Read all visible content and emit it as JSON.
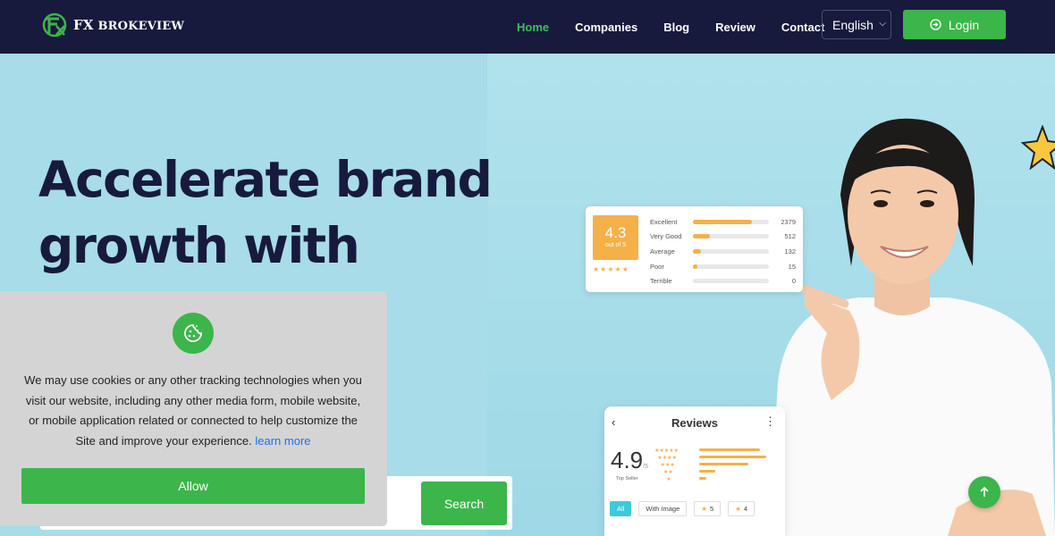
{
  "brand": {
    "name": "FX BROKEVIEW",
    "prefix": "FX",
    "suffix": "BROKEVIEW"
  },
  "nav": {
    "items": [
      {
        "label": "Home",
        "active": true
      },
      {
        "label": "Companies",
        "active": false
      },
      {
        "label": "Blog",
        "active": false
      },
      {
        "label": "Review",
        "active": false
      },
      {
        "label": "Contact",
        "active": false
      }
    ],
    "language": "English",
    "login_label": "Login"
  },
  "hero": {
    "headline_line1": "Accelerate brand",
    "headline_line2": "growth with"
  },
  "rating_card": {
    "score": "4.3",
    "score_caption": "out of 5",
    "rows": [
      {
        "label": "Excellent",
        "count": "2379",
        "fill": 0.78
      },
      {
        "label": "Very Good",
        "count": "512",
        "fill": 0.22
      },
      {
        "label": "Average",
        "count": "132",
        "fill": 0.1
      },
      {
        "label": "Poor",
        "count": "15",
        "fill": 0.06
      },
      {
        "label": "Terrible",
        "count": "0",
        "fill": 0
      }
    ]
  },
  "reviews_card": {
    "title": "Reviews",
    "score": "4.9",
    "score_out_of": "/5",
    "seller_label": "Top Seller",
    "filters": [
      "All",
      "With Image",
      "5",
      "4"
    ]
  },
  "search": {
    "button_label": "Search"
  },
  "cookie": {
    "text": "We may use cookies or any other tracking technologies when you visit our website, including any other media form, mobile website, or mobile application related or connected to help customize the Site and improve your experience.",
    "link_label": "learn more",
    "allow_label": "Allow"
  },
  "colors": {
    "navy": "#171a3d",
    "green": "#3cb54a",
    "accent_active": "#3fbf55",
    "hero_bg": "#a7dce8",
    "rating_orange": "#f5b04a"
  }
}
